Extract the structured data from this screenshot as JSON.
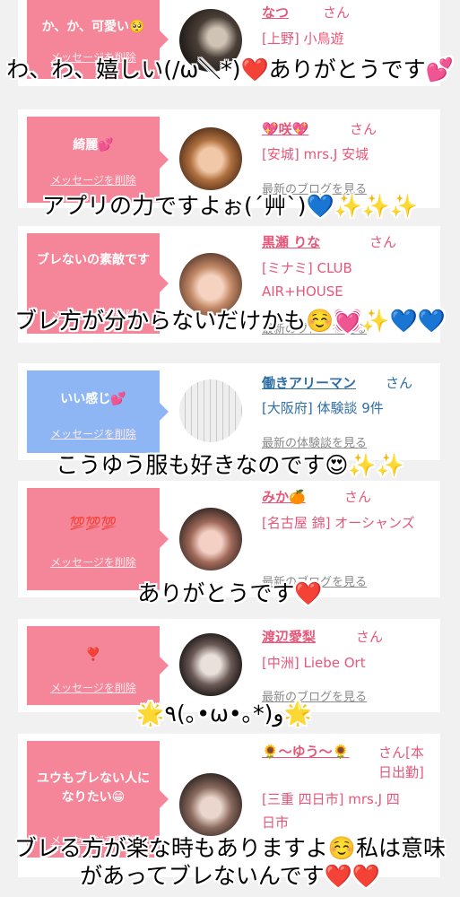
{
  "colors": {
    "accent_pink": "#f5869a",
    "accent_blue": "#8fb6f4",
    "name_pink": "#e8577a",
    "name_blue": "#2f6ea3"
  },
  "cards": [
    {
      "message": "か、か、可愛い🥺",
      "delete": "メッセージを削除",
      "name": "なつ",
      "san": "さん",
      "shop": "[上野] 小鳥遊",
      "link": ""
    },
    {
      "message": "綺麗💕",
      "delete": "メッセージを削除",
      "name": "💖咲💖",
      "san": "さん",
      "shop": "[安城] mrs.J 安城",
      "link": "最新のブログを見る"
    },
    {
      "message": "ブレないの素敵です",
      "delete": "メッセージを削除",
      "name": "黒瀬 りな",
      "san": "さん",
      "shop": "[ミナミ] CLUB AIR+HOUSE",
      "link": "最新のブログを見る"
    },
    {
      "message": "いい感じ💕",
      "delete": "メッセージを削除",
      "name": "働きアリーマン",
      "san": "さん",
      "shop": "[大阪府] 体験談 9件",
      "link": "最新の体験談を見る"
    },
    {
      "message": "💯💯💯",
      "delete": "メッセージを削除",
      "name": "みか🍊",
      "san": "さん",
      "shop": "[名古屋 錦] オーシャンズ",
      "link": "最新のブログを見る"
    },
    {
      "message": "❣️",
      "delete": "メッセージを削除",
      "name": "渡辺愛梨",
      "san": "さん",
      "shop": "[中洲] Liebe Ort",
      "link": "最新のブログを見る"
    },
    {
      "message": "ユウもブレない人になりたい😁",
      "delete": "メッセージを削除",
      "name": "🌻〜ゆう〜🌻",
      "san": "さん[本日出勤]",
      "shop": "[三重 四日市] mrs.J 四日市",
      "link": ""
    }
  ],
  "overlays": [
    "わ、わ、嬉しい(/ω＼*)❤️ありがとうです💕",
    "アプリの力ですよぉ(´艸`)💙✨✨✨",
    "ブレ方が分からないだけかも☺️💓✨💙💙",
    "こうゆう服も好きなのです😍✨✨",
    "ありがとうです❤️",
    "🌟٩(｡•ω•｡*)و🌟",
    "ブレる方が楽な時もありますよ☺️私は意味があってブレないんです❤️❤️"
  ]
}
